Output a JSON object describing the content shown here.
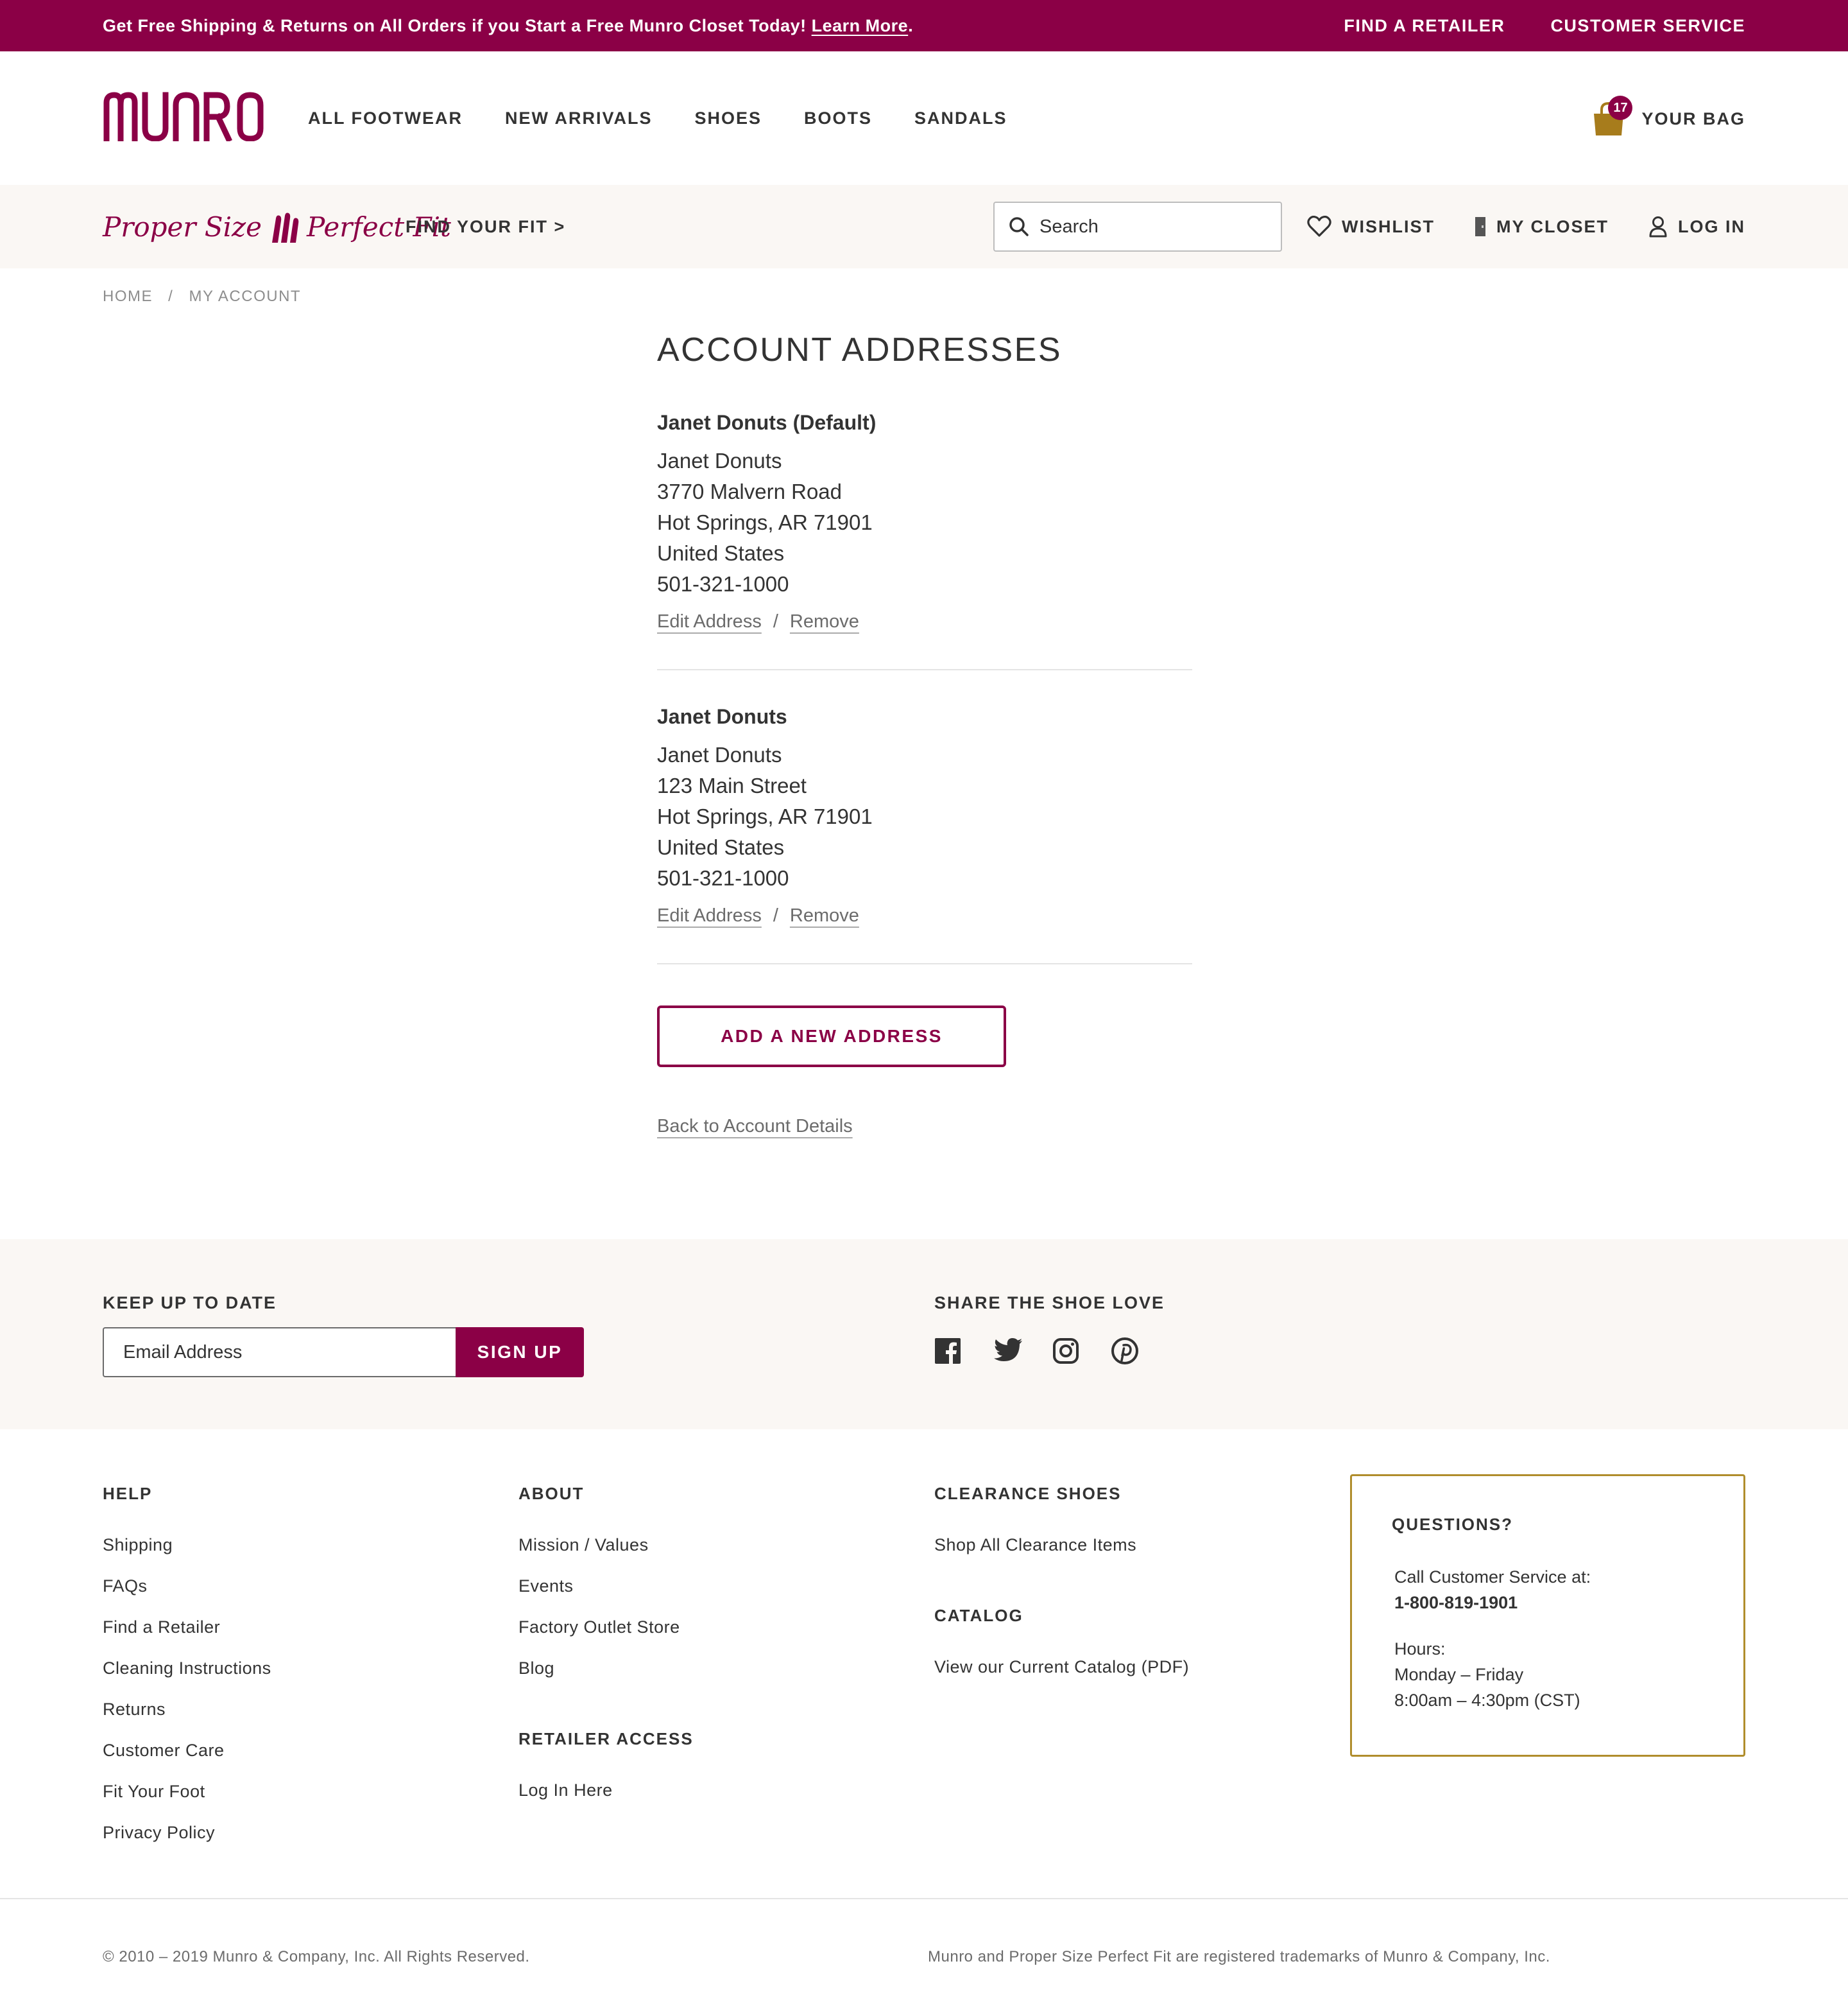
{
  "promo": {
    "message": "Get Free Shipping & Returns on All Orders if you Start a Free Munro Closet Today!",
    "link": "Learn More",
    "period": ".",
    "find_retailer": "FIND A RETAILER",
    "customer_service": "CUSTOMER SERVICE"
  },
  "header": {
    "logo": "MUNRO",
    "nav": [
      "ALL FOOTWEAR",
      "NEW ARRIVALS",
      "SHOES",
      "BOOTS",
      "SANDALS"
    ],
    "bag_count": "17",
    "bag_label": "YOUR BAG"
  },
  "subbar": {
    "fit_logo_left": "Proper Size",
    "fit_logo_right": "Perfect Fit",
    "find_fit": "FIND YOUR FIT >",
    "search_placeholder": "Search",
    "wishlist": "WISHLIST",
    "closet": "MY CLOSET",
    "login": "LOG IN"
  },
  "breadcrumb": {
    "home": "HOME",
    "separator": "/",
    "current": "MY ACCOUNT"
  },
  "page": {
    "title": "ACCOUNT ADDRESSES",
    "addresses": [
      {
        "heading": "Janet Donuts (Default)",
        "name": "Janet Donuts",
        "street": "3770 Malvern Road",
        "city": "Hot Springs, AR 71901",
        "country": "United States",
        "phone": "501-321-1000",
        "edit": "Edit Address",
        "remove": "Remove"
      },
      {
        "heading": "Janet Donuts",
        "name": "Janet Donuts",
        "street": "123 Main Street",
        "city": "Hot Springs, AR 71901",
        "country": "United States",
        "phone": "501-321-1000",
        "edit": "Edit Address",
        "remove": "Remove"
      }
    ],
    "action_separator": "/",
    "add_button": "ADD A NEW ADDRESS",
    "back_link": "Back to Account Details"
  },
  "newsletter": {
    "heading": "KEEP UP TO DATE",
    "email_placeholder": "Email Address",
    "signup": "SIGN UP",
    "social_heading": "SHARE THE SHOE LOVE",
    "social_icons": [
      "facebook-icon",
      "twitter-icon",
      "instagram-icon",
      "pinterest-icon"
    ]
  },
  "footer": {
    "help": {
      "heading": "HELP",
      "links": [
        "Shipping",
        "FAQs",
        "Find a Retailer",
        "Cleaning Instructions",
        "Returns",
        "Customer Care",
        "Fit Your Foot",
        "Privacy Policy"
      ]
    },
    "about": {
      "heading": "ABOUT",
      "links": [
        "Mission / Values",
        "Events",
        "Factory Outlet Store",
        "Blog"
      ]
    },
    "retailer": {
      "heading": "RETAILER ACCESS",
      "links": [
        "Log In Here"
      ]
    },
    "clearance": {
      "heading": "CLEARANCE SHOES",
      "links": [
        "Shop All Clearance Items"
      ]
    },
    "catalog": {
      "heading": "CATALOG",
      "links": [
        "View our Current Catalog (PDF)"
      ]
    },
    "questions": {
      "heading": "QUESTIONS?",
      "call": "Call Customer Service at:",
      "phone": "1-800-819-1901",
      "hours_label": "Hours:",
      "days": "Monday – Friday",
      "times": "8:00am – 4:30pm (CST)"
    },
    "copyright": "© 2010 – 2019 Munro & Company, Inc. All Rights Reserved.",
    "trademark": "Munro and Proper Size Perfect Fit are registered trademarks of Munro & Company, Inc."
  },
  "colors": {
    "brand": "#8b0046",
    "gold": "#b08d2c",
    "cream": "#faf7f4",
    "text": "#333333"
  }
}
